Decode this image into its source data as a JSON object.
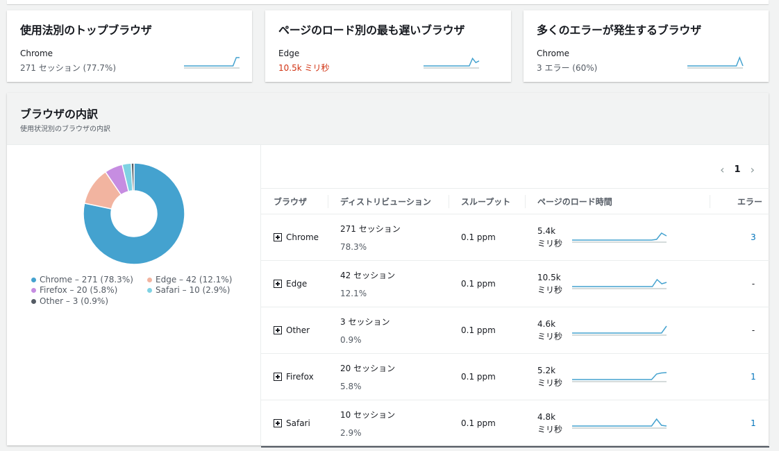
{
  "cards": [
    {
      "title": "使用法別のトップブラウザ",
      "browser": "Chrome",
      "metric": "271 セッション (77.7%)",
      "metric_color": "#545b64",
      "spark": [
        0,
        0,
        0,
        0,
        0,
        0,
        0,
        0,
        0,
        0,
        0,
        0,
        0,
        0,
        0,
        0,
        1,
        1
      ]
    },
    {
      "title": "ページのロード別の最も遅いブラウザ",
      "browser": "Edge",
      "metric": "10.5k ミリ秒",
      "metric_color": "#d13212",
      "spark": [
        0,
        0,
        0,
        0,
        0,
        0,
        0,
        0,
        0,
        0,
        0,
        0,
        0,
        0,
        0,
        0.9,
        0.4,
        0.6
      ]
    },
    {
      "title": "多くのエラーが発生するブラウザ",
      "browser": "Chrome",
      "metric": "3 エラー (60%)",
      "metric_color": "#545b64",
      "spark": [
        0,
        0,
        0,
        0,
        0,
        0,
        0,
        0,
        0,
        0,
        0,
        0,
        0,
        0,
        0,
        0,
        1,
        0
      ]
    }
  ],
  "panel": {
    "title": "ブラウザの内訳",
    "subtitle": "使用状況別のブラウザの内訳"
  },
  "chart_data": {
    "type": "pie",
    "categories": [
      "Chrome",
      "Edge",
      "Firefox",
      "Safari",
      "Other"
    ],
    "values": [
      271,
      42,
      20,
      10,
      3
    ],
    "percent": [
      78.3,
      12.1,
      5.8,
      2.9,
      0.9
    ],
    "colors": [
      "#44a2cf",
      "#f2b4a0",
      "#c68de1",
      "#7fd2e3",
      "#545b64"
    ],
    "legend": [
      "Chrome – 271 (78.3%)",
      "Edge – 42 (12.1%)",
      "Firefox – 20 (5.8%)",
      "Safari – 10 (2.9%)",
      "Other – 3 (0.9%)"
    ],
    "legend_position": "bottom"
  },
  "pager": {
    "page": "1"
  },
  "table": {
    "headers": [
      "ブラウザ",
      "ディストリビューション",
      "スループット",
      "ページのロード時間",
      "エラー"
    ],
    "rows": [
      {
        "browser": "Chrome",
        "sessions": "271 セッション",
        "share": "78.3%",
        "throughput": "0.1 ppm",
        "load": "5.4k",
        "unit": "ミリ秒",
        "errors": "3",
        "err_link": true,
        "spark": [
          0,
          0,
          0,
          0,
          0,
          0,
          0,
          0,
          0,
          0,
          0,
          0,
          0,
          0,
          0,
          0,
          0,
          0.1,
          1,
          0.6
        ]
      },
      {
        "browser": "Edge",
        "sessions": "42 セッション",
        "share": "12.1%",
        "throughput": "0.1 ppm",
        "load": "10.5k",
        "unit": "ミリ秒",
        "errors": "-",
        "err_link": false,
        "spark": [
          0,
          0,
          0,
          0,
          0,
          0,
          0,
          0,
          0,
          0,
          0,
          0,
          0,
          0,
          0,
          0,
          0,
          0,
          1,
          0.4,
          0.6
        ]
      },
      {
        "browser": "Other",
        "sessions": "3 セッション",
        "share": "0.9%",
        "throughput": "0.1 ppm",
        "load": "4.6k",
        "unit": "ミリ秒",
        "errors": "-",
        "err_link": false,
        "spark": [
          0,
          0,
          0,
          0,
          0,
          0,
          0,
          0,
          0,
          0,
          0,
          0,
          0,
          0,
          0,
          0,
          0,
          0,
          0,
          1
        ]
      },
      {
        "browser": "Firefox",
        "sessions": "20 セッション",
        "share": "5.8%",
        "throughput": "0.1 ppm",
        "load": "5.2k",
        "unit": "ミリ秒",
        "errors": "1",
        "err_link": true,
        "spark": [
          0,
          0,
          0,
          0,
          0,
          0,
          0,
          0,
          0,
          0,
          0,
          0,
          0,
          0,
          0,
          0,
          0,
          0.8,
          0.95,
          1
        ]
      },
      {
        "browser": "Safari",
        "sessions": "10 セッション",
        "share": "2.9%",
        "throughput": "0.1 ppm",
        "load": "4.8k",
        "unit": "ミリ秒",
        "errors": "1",
        "err_link": true,
        "spark": [
          0,
          0,
          0,
          0,
          0,
          0,
          0,
          0,
          0,
          0,
          0,
          0,
          0,
          0,
          0,
          0,
          0,
          1,
          0.1,
          0
        ]
      }
    ]
  },
  "colors": {
    "accent": "#44a2cf",
    "link": "#0073bb",
    "error": "#d13212"
  }
}
